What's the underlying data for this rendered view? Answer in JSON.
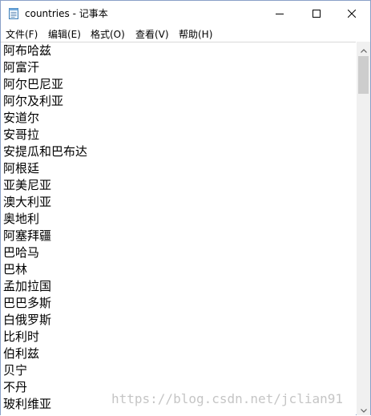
{
  "window": {
    "title": "countries - 记事本"
  },
  "menu": {
    "file": "文件(F)",
    "edit": "编辑(E)",
    "format": "格式(O)",
    "view": "查看(V)",
    "help": "帮助(H)"
  },
  "lines": [
    "阿布哈兹",
    "阿富汗",
    "阿尔巴尼亚",
    "阿尔及利亚",
    "安道尔",
    "安哥拉",
    "安提瓜和巴布达",
    "阿根廷",
    "亚美尼亚",
    "澳大利亚",
    "奥地利",
    "阿塞拜疆",
    "巴哈马",
    "巴林",
    "孟加拉国",
    "巴巴多斯",
    "白俄罗斯",
    "比利时",
    "伯利兹",
    "贝宁",
    "不丹",
    "玻利维亚"
  ],
  "watermark": "https://blog.csdn.net/jclian91",
  "icons": {
    "app": "notepad-icon",
    "minimize": "minimize-icon",
    "maximize": "maximize-icon",
    "close": "close-icon",
    "scroll_up": "chevron-up-icon",
    "scroll_down": "chevron-down-icon"
  }
}
